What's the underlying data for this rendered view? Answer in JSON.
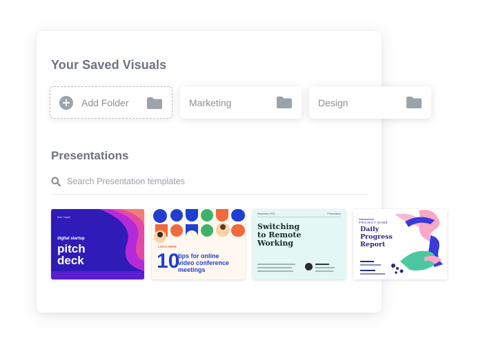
{
  "saved_visuals": {
    "title": "Your Saved Visuals",
    "folders": [
      {
        "label": "Add Folder",
        "icon": "plus-circle-icon"
      },
      {
        "label": "Marketing",
        "icon": "folder-icon"
      },
      {
        "label": "Design",
        "icon": "folder-icon"
      }
    ]
  },
  "presentations": {
    "title": "Presentations",
    "search_placeholder": "Search Presentation templates",
    "templates": [
      {
        "brand": "lime maple",
        "subtitle": "digital startup",
        "title_line1": "pitch",
        "title_line2": "deck"
      },
      {
        "brand": "LOGO HERE",
        "number": "10",
        "title_line1": "tips for online",
        "title_line2": "video conference",
        "title_line3": "meetings"
      },
      {
        "date": "September 2021",
        "header_right": "Presentation",
        "title_line1": "Switching",
        "title_line2": "to Remote",
        "title_line3": "Working"
      },
      {
        "kicker": "PROJECT NAME",
        "title_line1": "Daily",
        "title_line2": "Progress",
        "title_line3": "Report"
      }
    ]
  },
  "colors": {
    "heading": "#6b7280",
    "muted_text": "#8a8f97",
    "folder_icon": "#9ca3ab",
    "pitch_bg": "#2e1bb8",
    "tips_accent": "#f06a3d",
    "tips_title": "#1f3fd1",
    "remote_bg": "#e3f7f4",
    "report_title": "#2a2a7a"
  }
}
